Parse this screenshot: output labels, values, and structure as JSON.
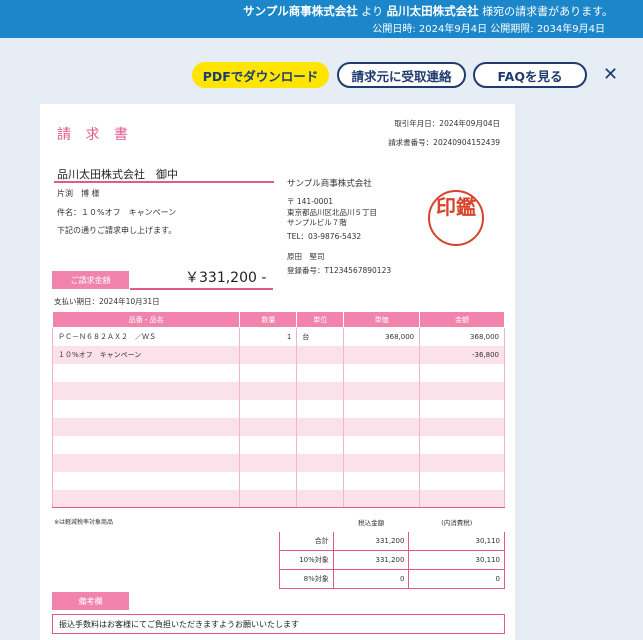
{
  "banner": {
    "line1_sender": "サンプル商事株式会社",
    "line1_mid": " より ",
    "line1_recipient": "品川太田株式会社",
    "line1_tail": " 様宛の請求書があります。",
    "line2": "公開日時: 2024年9月4日 公開期限: 2034年9月4日"
  },
  "actions": {
    "pdf_download": "PDFでダウンロード",
    "contact_issuer": "請求元に受取連絡",
    "faq": "FAQを見る",
    "close": "✕"
  },
  "invoice": {
    "title": "請 求 書",
    "date_line": "取引年月日：2024年09月04日",
    "number_line": "請求書番号：20240904152439",
    "client_name": "品川太田株式会社　御中",
    "client_person": "片渕　博 様",
    "subject": "件名：１０%オフ　キャンペーン",
    "intro": "下記の通りご請求申し上げます。",
    "issuer": {
      "company": "サンプル商事株式会社",
      "postal": "〒 141-0001",
      "address1": "東京都品川区北品川５丁目",
      "address2": "サンプルビル７階",
      "tel": "TEL：03-9876-5432",
      "person": "原田　堅司",
      "registration": "登録番号：T1234567890123"
    },
    "stamp_text": "印鑑",
    "amount_label": "ご請求金額",
    "amount": "￥331,200 -",
    "due": "支払い期日：2024年10月31日",
    "columns": [
      "品番・品名",
      "数量",
      "単位",
      "単価",
      "金額"
    ],
    "items": [
      [
        "ＰＣ－Ｎ６８２ＡＸ２　／ＷＳ",
        "1",
        "台",
        "368,000",
        "368,000"
      ],
      [
        "１０%オフ　キャンペーン",
        "",
        "",
        "",
        "-36,800"
      ],
      [
        "",
        "",
        "",
        "",
        ""
      ],
      [
        "",
        "",
        "",
        "",
        ""
      ],
      [
        "",
        "",
        "",
        "",
        ""
      ],
      [
        "",
        "",
        "",
        "",
        ""
      ],
      [
        "",
        "",
        "",
        "",
        ""
      ],
      [
        "",
        "",
        "",
        "",
        ""
      ],
      [
        "",
        "",
        "",
        "",
        ""
      ],
      [
        "",
        "",
        "",
        "",
        ""
      ]
    ],
    "reduced_tax_note": "※は軽減税率対象商品",
    "summary_headers": [
      "税込金額",
      "(内消費税)"
    ],
    "summary_rows": [
      [
        "合計",
        "331,200",
        "30,110"
      ],
      [
        "10%対象",
        "331,200",
        "30,110"
      ],
      [
        "8%対象",
        "0",
        "0"
      ]
    ],
    "remarks_label": "備考欄",
    "remarks": "振込手数料はお客様にてご負担いただきますようお願いいたします"
  }
}
